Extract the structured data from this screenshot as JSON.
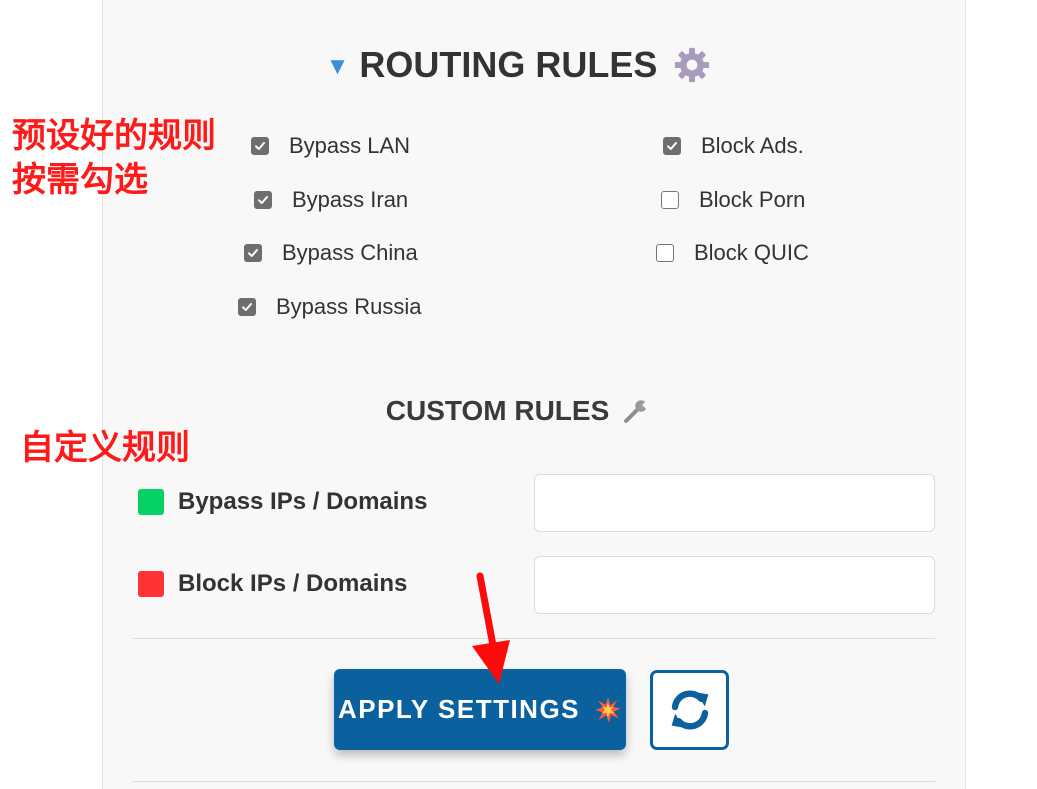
{
  "routing": {
    "title": "ROUTING RULES",
    "rules_left": [
      {
        "label": "Bypass LAN",
        "checked": true
      },
      {
        "label": "Bypass Iran",
        "checked": true
      },
      {
        "label": "Bypass China",
        "checked": true
      },
      {
        "label": "Bypass Russia",
        "checked": true
      }
    ],
    "rules_right": [
      {
        "label": "Block Ads.",
        "checked": true
      },
      {
        "label": "Block Porn",
        "checked": false
      },
      {
        "label": "Block QUIC",
        "checked": false
      }
    ]
  },
  "custom": {
    "title": "CUSTOM RULES",
    "bypass_label": "Bypass IPs / Domains",
    "bypass_value": "",
    "block_label": "Block IPs / Domains",
    "block_value": ""
  },
  "actions": {
    "apply_label": "APPLY SETTINGS"
  },
  "annotations": {
    "preset_line1": "预设好的规则",
    "preset_line2": "按需勾选",
    "custom": "自定义规则"
  },
  "icons": {
    "title_toggle": "triangle-down-icon",
    "routing_settings": "gear-icon",
    "custom_tools": "wrench-icon",
    "apply_decoration": "collision-icon",
    "refresh": "refresh-icon",
    "bypass_swatch": "green-square-icon",
    "block_swatch": "red-square-icon",
    "annotation_arrow": "red-arrow-icon"
  },
  "colors": {
    "accent_blue": "#0b609e",
    "toggle_blue": "#3a8fd8",
    "bypass_green": "#05d164",
    "block_red": "#ff3333",
    "annotation_red": "#ff1a1a"
  }
}
